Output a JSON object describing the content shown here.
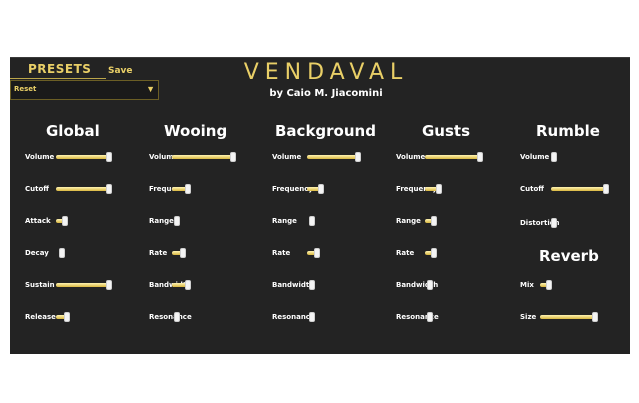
{
  "header": {
    "presets_label": "PRESETS",
    "save_label": "Save",
    "preset_selected": "Reset",
    "title": "VENDAVAL",
    "author": "by Caio M. Jiacomini"
  },
  "colors": {
    "accent": "#e9cf67",
    "panel": "#232323",
    "text": "#ffffff"
  },
  "sections": {
    "global": {
      "title": "Global",
      "params": [
        {
          "label": "Volume",
          "value": 1.0
        },
        {
          "label": "Cutoff",
          "value": 1.0
        },
        {
          "label": "Attack",
          "value": 0.12
        },
        {
          "label": "Decay",
          "value": 0.05
        },
        {
          "label": "Sustain",
          "value": 1.0
        },
        {
          "label": "Release",
          "value": 0.15
        }
      ]
    },
    "wooing": {
      "title": "Wooing",
      "params": [
        {
          "label": "Volume",
          "value": 1.0
        },
        {
          "label": "Frequency",
          "value": 0.22
        },
        {
          "label": "Range",
          "value": 0.04
        },
        {
          "label": "Rate",
          "value": 0.14
        },
        {
          "label": "Bandwidth",
          "value": 0.22
        },
        {
          "label": "Resonance",
          "value": 0.04
        }
      ]
    },
    "background": {
      "title": "Background",
      "params": [
        {
          "label": "Volume",
          "value": 1.0
        },
        {
          "label": "Frequency",
          "value": 0.22
        },
        {
          "label": "Range",
          "value": 0.04
        },
        {
          "label": "Rate",
          "value": 0.14
        },
        {
          "label": "Bandwidth",
          "value": 0.04
        },
        {
          "label": "Resonance",
          "value": 0.04
        }
      ]
    },
    "gusts": {
      "title": "Gusts",
      "params": [
        {
          "label": "Volume",
          "value": 1.0
        },
        {
          "label": "Frequency",
          "value": 0.22
        },
        {
          "label": "Range",
          "value": 0.12
        },
        {
          "label": "Rate",
          "value": 0.12
        },
        {
          "label": "Bandwidth",
          "value": 0.04
        },
        {
          "label": "Resonance",
          "value": 0.04
        }
      ]
    },
    "rumble": {
      "title": "Rumble",
      "params": [
        {
          "label": "Volume",
          "value": 0.0
        },
        {
          "label": "Cutoff",
          "value": 1.0
        },
        {
          "label": "Distortion",
          "value": 0.0
        }
      ]
    },
    "reverb": {
      "title": "Reverb",
      "params": [
        {
          "label": "Mix",
          "value": 0.12
        },
        {
          "label": "Size",
          "value": 1.0
        }
      ]
    }
  }
}
